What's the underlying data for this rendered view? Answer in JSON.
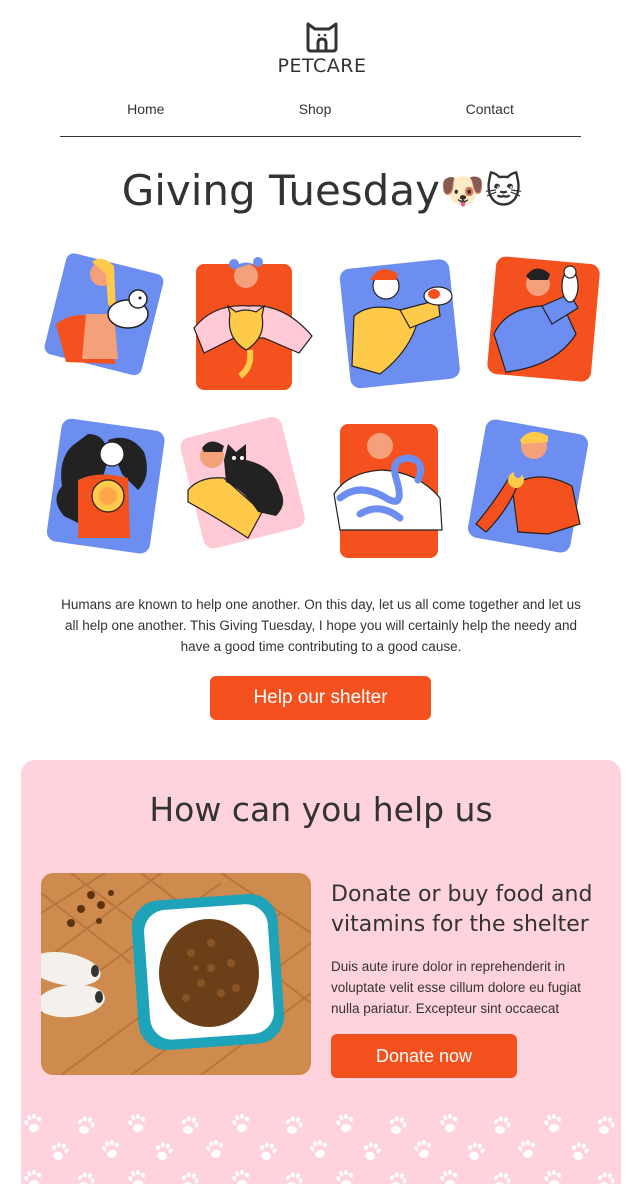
{
  "brand": {
    "name": "PETCARE"
  },
  "nav": {
    "items": [
      {
        "label": "Home"
      },
      {
        "label": "Shop"
      },
      {
        "label": "Contact"
      }
    ]
  },
  "hero": {
    "title": "Giving Tuesday",
    "emoji": "🐶🐱"
  },
  "illustrations": [
    {
      "name": "person-with-white-dog"
    },
    {
      "name": "person-with-ginger-cat"
    },
    {
      "name": "person-with-hamster"
    },
    {
      "name": "person-with-white-rat"
    },
    {
      "name": "person-with-lion-toy"
    },
    {
      "name": "person-with-black-cat"
    },
    {
      "name": "person-with-snake"
    },
    {
      "name": "person-with-bird"
    }
  ],
  "intro": {
    "text": "Humans are known to help one another. On this day, let us all come together and let us all help one another. This Giving Tuesday, I hope you will certainly help the needy and have a good time contributing to a good cause.",
    "button_label": "Help our shelter"
  },
  "help": {
    "title": "How can you help us",
    "card": {
      "heading": "Donate or buy food and vitamins for the shelter",
      "text": "Duis aute irure dolor in reprehenderit in voluptate velit esse cillum dolore eu fugiat nulla pariatur. Excepteur sint occaecat",
      "button_label": "Donate now"
    }
  },
  "colors": {
    "accent": "#f5511e",
    "section_bg": "#ffd3dd",
    "tile_blue": "#6c8ef0",
    "tile_orange": "#f5511e",
    "tile_pink": "#ffc9d6"
  }
}
